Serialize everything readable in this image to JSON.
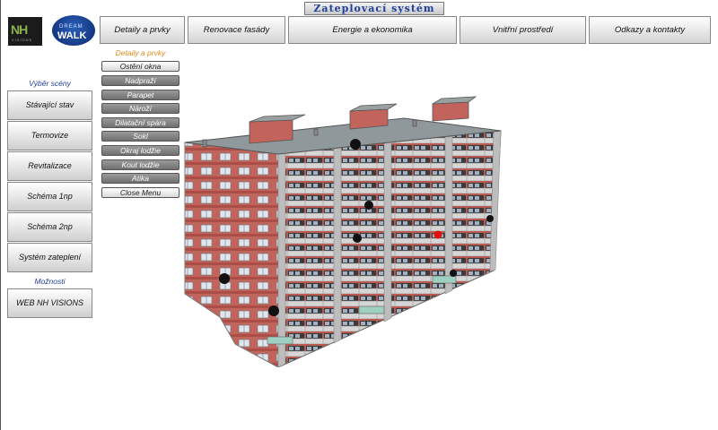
{
  "title": "Zateplovací systém",
  "logos": {
    "nh_text": "NH",
    "nh_sub": "VISIONS",
    "dw_top": "DREAM",
    "dw_bottom": "WALK"
  },
  "topnav": [
    {
      "label": "Detaily a prvky"
    },
    {
      "label": "Renovace fasády"
    },
    {
      "label": "Energie a ekonomika"
    },
    {
      "label": "Vnitřní prostředí"
    },
    {
      "label": "Odkazy a kontakty"
    }
  ],
  "sidebar": {
    "scene_heading": "Výběr scény",
    "scene_buttons": [
      {
        "label": "Stávající stav"
      },
      {
        "label": "Termovize"
      },
      {
        "label": "Revitalizace"
      },
      {
        "label": "Schéma 1np"
      },
      {
        "label": "Schéma 2np"
      },
      {
        "label": "Systém zateplení"
      }
    ],
    "options_heading": "Možnosti",
    "options_buttons": [
      {
        "label": "WEB NH VISIONS"
      }
    ]
  },
  "submenu": {
    "heading": "Detaily a prvky",
    "items": [
      {
        "label": "Ostění okna"
      },
      {
        "label": "Nadpraží"
      },
      {
        "label": "Parapet"
      },
      {
        "label": "Nároží"
      },
      {
        "label": "Dilatační spára"
      },
      {
        "label": "Sokl"
      },
      {
        "label": "Okraj lodžie"
      },
      {
        "label": "Kout lodžie"
      },
      {
        "label": "Atika"
      },
      {
        "label": "Close Menu"
      }
    ]
  },
  "hotspot_colors": {
    "default": "#111111",
    "active": "#e01010"
  },
  "colors": {
    "brick": "#c2645c",
    "concrete": "#b9b9b9",
    "title_text": "#1f3f9a",
    "accent_orange": "#e08a1c"
  }
}
